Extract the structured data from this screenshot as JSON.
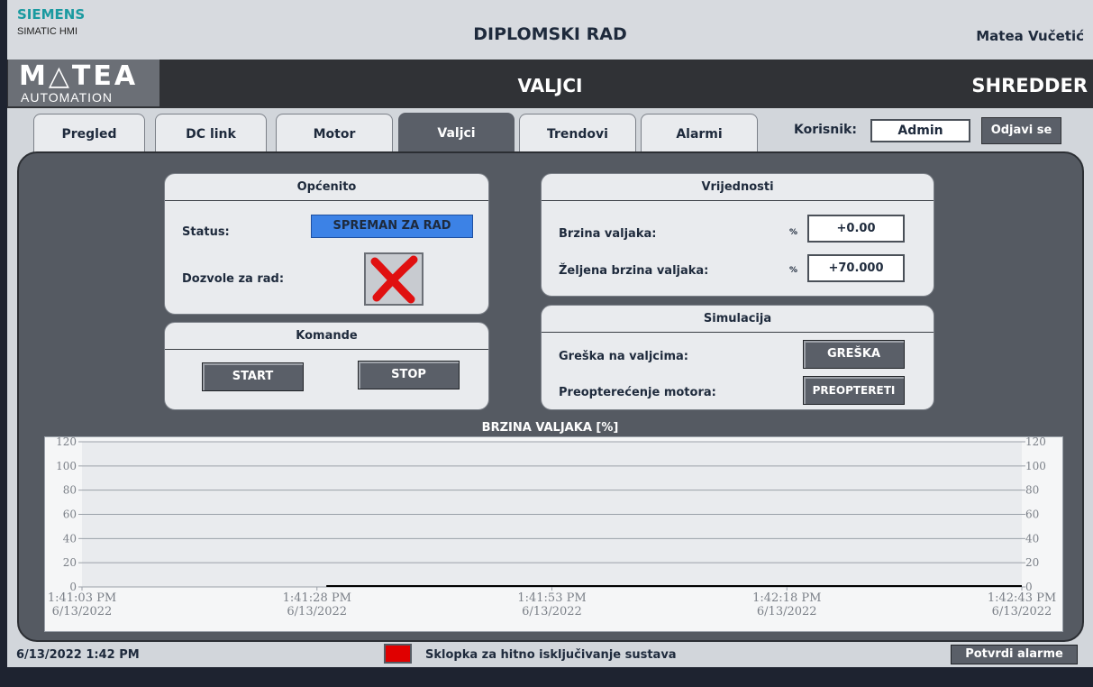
{
  "header": {
    "brand": "SIEMENS",
    "product": "SIMATIC HMI",
    "title": "DIPLOMSKI RAD",
    "user_name": "Matea Vučetić"
  },
  "subheader": {
    "logo_top": "M△TEA",
    "logo_bottom": "AUTOMATION",
    "title": "VALJCI",
    "right": "SHREDDER"
  },
  "tabs": [
    {
      "label": "Pregled",
      "active": false
    },
    {
      "label": "DC link",
      "active": false
    },
    {
      "label": "Motor",
      "active": false
    },
    {
      "label": "Valjci",
      "active": true
    },
    {
      "label": "Trendovi",
      "active": false
    },
    {
      "label": "Alarmi",
      "active": false
    }
  ],
  "user": {
    "label": "Korisnik:",
    "value": "Admin",
    "logout": "Odjavi se"
  },
  "general": {
    "title": "Općenito",
    "status_label": "Status:",
    "status_value": "SPREMAN ZA RAD",
    "permits_label": "Dozvole za rad:",
    "permits_icon": "red-x-icon"
  },
  "commands": {
    "title": "Komande",
    "start": "START",
    "stop": "STOP"
  },
  "values": {
    "title": "Vrijednosti",
    "speed_label": "Brzina valjaka:",
    "speed_unit": "%",
    "speed_value": "+0.00",
    "setpoint_label": "Željena brzina valjaka:",
    "setpoint_unit": "%",
    "setpoint_value": "+70.000"
  },
  "simulation": {
    "title": "Simulacija",
    "fault_label": "Greška na valjcima:",
    "fault_button": "GREŠKA",
    "overload_label": "Preopterećenje motora:",
    "overload_button": "PREOPTERETI"
  },
  "chart_data": {
    "type": "line",
    "title": "BRZINA VALJAKA [%]",
    "ylim": [
      0,
      120
    ],
    "y_ticks": [
      "0",
      "20",
      "40",
      "60",
      "80",
      "100",
      "120"
    ],
    "x_ticks": [
      {
        "time": "1:41:03 PM",
        "date": "6/13/2022"
      },
      {
        "time": "1:41:28 PM",
        "date": "6/13/2022"
      },
      {
        "time": "1:41:53 PM",
        "date": "6/13/2022"
      },
      {
        "time": "1:42:18 PM",
        "date": "6/13/2022"
      },
      {
        "time": "1:42:43 PM",
        "date": "6/13/2022"
      }
    ],
    "grid": true,
    "series": [
      {
        "values": [
          0,
          0,
          0,
          0
        ],
        "start_time": "1:41:29 PM",
        "end_time": "1:42:43 PM",
        "color": "#000000"
      }
    ]
  },
  "footer": {
    "datetime": "6/13/2022 1:42 PM",
    "message": "Sklopka za hitno isključivanje sustava",
    "ack_button": "Potvrdi alarme"
  },
  "colors": {
    "accent_blue": "#3c82e6",
    "alarm_red": "#e00000",
    "panel_dark": "#555a62"
  }
}
